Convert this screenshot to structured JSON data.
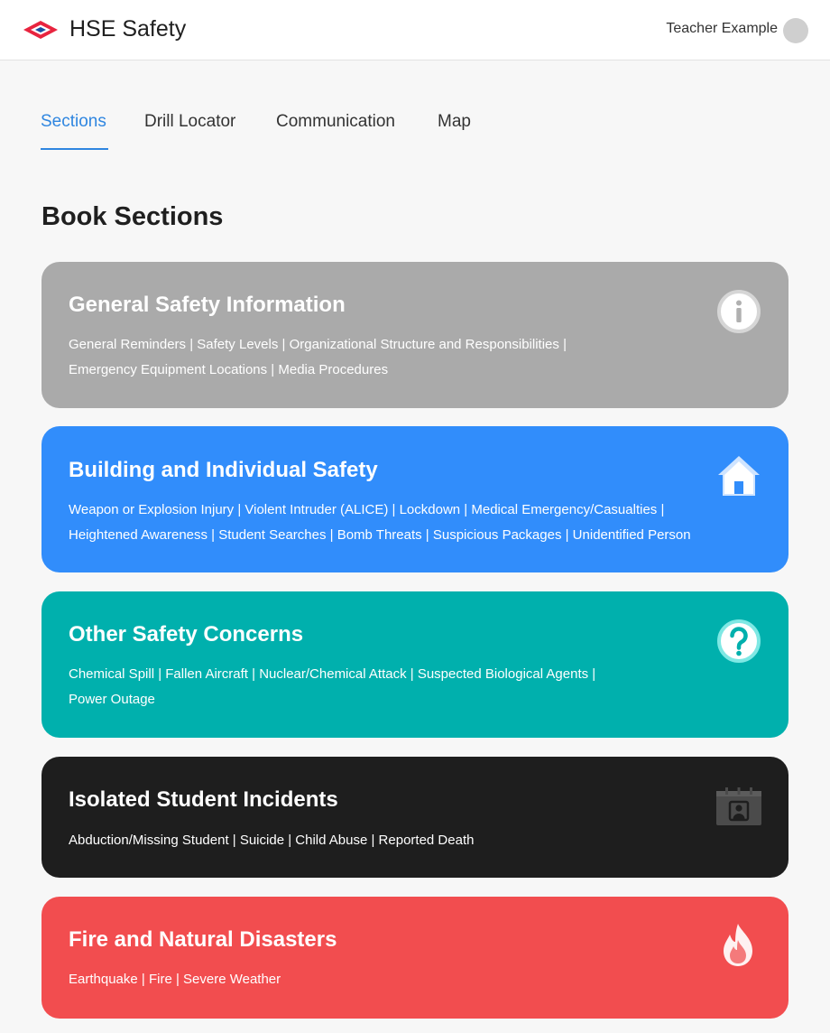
{
  "header": {
    "app_title": "HSE Safety",
    "user_name": "Teacher Example",
    "logo_icon": "hse-logo-icon"
  },
  "tabs": [
    {
      "label": "Sections",
      "active": true
    },
    {
      "label": "Drill Locator",
      "active": false
    },
    {
      "label": "Communication",
      "active": false
    },
    {
      "label": "Map",
      "active": false
    }
  ],
  "colors": {
    "accent": "#2f86e0",
    "card_general": "#aaaaaa",
    "card_building": "#318dfb",
    "card_other": "#00b0ad",
    "card_isolated": "#1e1e1e",
    "card_fire": "#f24d4f"
  },
  "page_heading": "Book Sections",
  "sections": [
    {
      "title": "General Safety Information",
      "items_line1": "General Reminders | Safety Levels | Organizational Structure and Responsibilities |",
      "items_line2": "Emergency Equipment Locations | Media Procedures",
      "icon": "info-icon"
    },
    {
      "title": "Building and Individual Safety",
      "items_line1": "Weapon or Explosion Injury | Violent Intruder (ALICE) | Lockdown | Medical Emergency/Casualties |",
      "items_line2": "Heightened Awareness | Student Searches | Bomb Threats | Suspicious Packages | Unidentified Person",
      "icon": "home-icon"
    },
    {
      "title": "Other Safety Concerns",
      "items_line1": "Chemical Spill | Fallen Aircraft | Nuclear/Chemical Attack | Suspected Biological Agents |",
      "items_line2": "Power Outage",
      "icon": "question-icon"
    },
    {
      "title": "Isolated Student Incidents",
      "items_line1": "Abduction/Missing Student | Suicide | Child Abuse | Reported Death",
      "icon": "id-card-icon"
    },
    {
      "title": "Fire and Natural Disasters",
      "items_line1": "Earthquake | Fire | Severe Weather",
      "icon": "fire-icon"
    }
  ]
}
